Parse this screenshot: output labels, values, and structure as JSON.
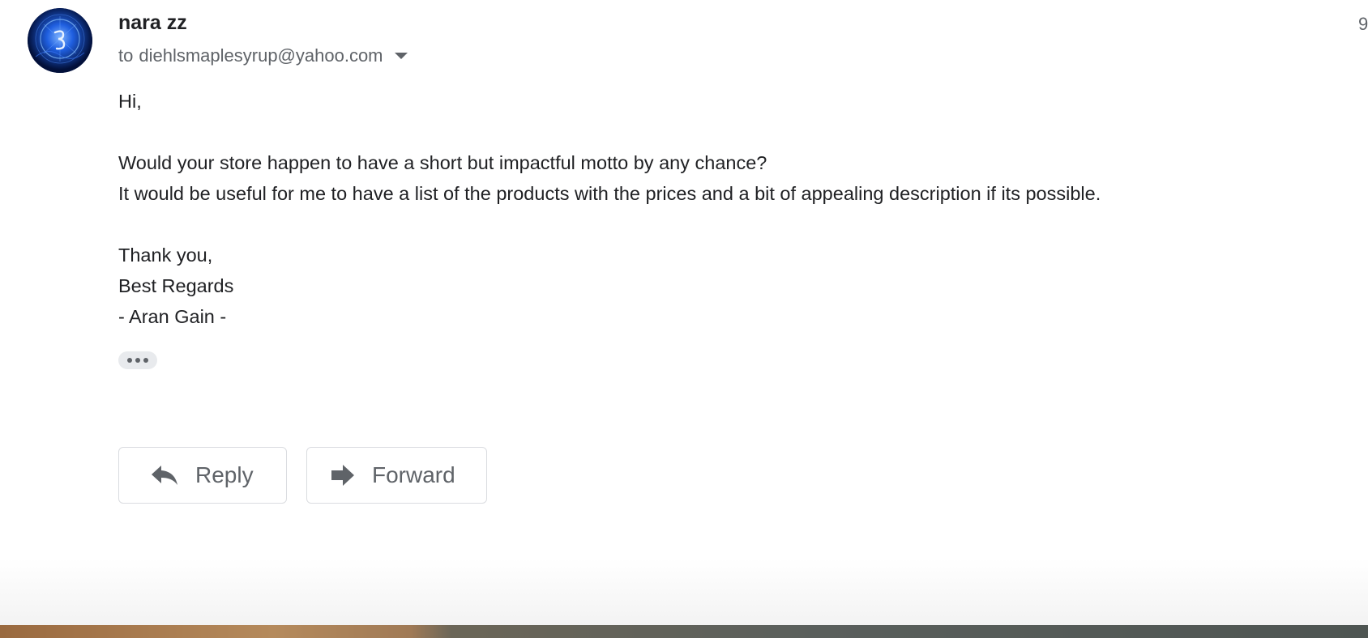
{
  "message": {
    "sender": {
      "name": "nara zz"
    },
    "recipient": {
      "prefix": "to",
      "address": "diehlsmaplesyrup@yahoo.com"
    },
    "timestamp_visible": "9",
    "body": {
      "greeting": "Hi,",
      "line1": "Would your store happen to have a short but impactful motto by any chance?",
      "line2": "It would be useful for me to have a list of the products with the prices and a bit of appealing description if its possible.",
      "closing1": "Thank you,",
      "closing2": "Best Regards",
      "signature": "- Aran Gain -"
    }
  },
  "actions": {
    "reply_label": "Reply",
    "forward_label": "Forward"
  },
  "icons": {
    "avatar": "avatar-image",
    "recipient_details": "caret-down-icon",
    "show_trimmed": "more-horiz-icon",
    "reply": "reply-icon",
    "forward": "forward-icon"
  },
  "colors": {
    "text_primary": "#202124",
    "text_secondary": "#5f6368",
    "button_border": "#dadce0",
    "chip_bg": "#e8eaed"
  }
}
